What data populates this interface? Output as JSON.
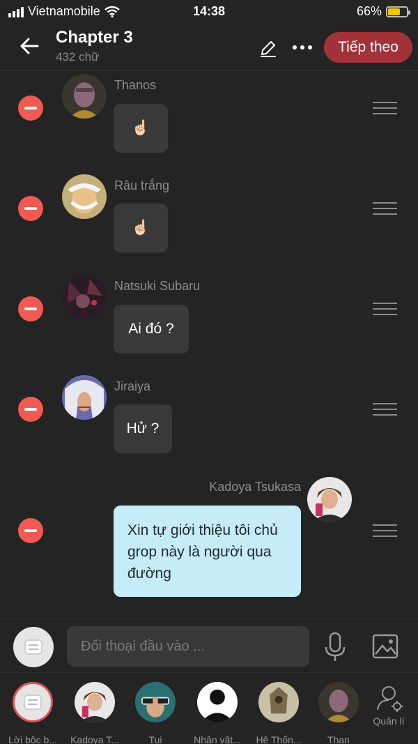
{
  "status_bar": {
    "carrier": "Vietnamobile",
    "time": "14:38",
    "battery": "66%",
    "battery_level": 0.66
  },
  "header": {
    "title": "Chapter 3",
    "subtitle": "432 chữ",
    "next_label": "Tiếp theo"
  },
  "messages": [
    {
      "name": "Thanos",
      "text": "☝🏻"
    },
    {
      "name": "Râu trắng",
      "text": "☝🏻"
    },
    {
      "name": "Natsuki Subaru",
      "text": "Ai đó ?"
    },
    {
      "name": "Jiraiya",
      "text": "Hử ?"
    },
    {
      "name": "Kadoya Tsukasa",
      "text": "Xin tự giới thiệu tôi chủ grop này là người qua đường"
    }
  ],
  "input": {
    "placeholder": "Đối thoại đầu vào ..."
  },
  "characters": [
    {
      "label": "Lời bộc b..."
    },
    {
      "label": "Kadoya T..."
    },
    {
      "label": "Tui"
    },
    {
      "label": "Nhân vật..."
    },
    {
      "label": "Hệ Thốn..."
    },
    {
      "label": "Than"
    }
  ],
  "manage_label": "Quản lí",
  "colors": {
    "accent": "#a3313a",
    "remove": "#f05a53",
    "self_bubble": "#c6ecf8"
  }
}
